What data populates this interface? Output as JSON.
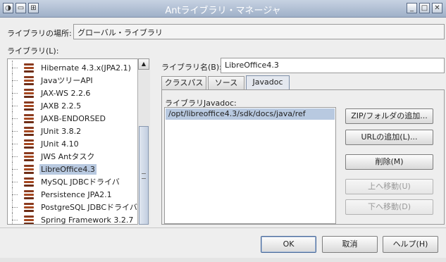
{
  "window": {
    "title": "Antライブラリ・マネージャ",
    "controls": {
      "minimize": "_",
      "maximize": "□",
      "close": "✕"
    }
  },
  "location": {
    "label": "ライブラリの場所:",
    "value": "グローバル・ライブラリ"
  },
  "libraries": {
    "label": "ライブラリ(L):",
    "items": [
      {
        "name": "Hibernate 4.3.x(JPA2.1)",
        "selected": false
      },
      {
        "name": "JavaツリーAPI",
        "selected": false
      },
      {
        "name": "JAX-WS 2.2.6",
        "selected": false
      },
      {
        "name": "JAXB 2.2.5",
        "selected": false
      },
      {
        "name": "JAXB-ENDORSED",
        "selected": false
      },
      {
        "name": "JUnit 3.8.2",
        "selected": false
      },
      {
        "name": "JUnit 4.10",
        "selected": false
      },
      {
        "name": "JWS Antタスク",
        "selected": false
      },
      {
        "name": "LibreOffice4.3",
        "selected": true
      },
      {
        "name": "MySQL JDBCドライバ",
        "selected": false
      },
      {
        "name": "Persistence JPA2.1",
        "selected": false
      },
      {
        "name": "PostgreSQL JDBCドライバ",
        "selected": false
      },
      {
        "name": "Spring Framework 3.2.7",
        "selected": false
      }
    ]
  },
  "library_name": {
    "label": "ライブラリ名(B):",
    "value": "LibreOffice4.3"
  },
  "tabs": [
    {
      "label": "クラスパス",
      "active": false
    },
    {
      "label": "ソース",
      "active": false
    },
    {
      "label": "Javadoc",
      "active": true
    }
  ],
  "javadoc": {
    "label": "ライブラリJavadoc:",
    "paths": [
      "/opt/libreoffice4.3/sdk/docs/java/ref"
    ]
  },
  "side_buttons": {
    "add_zip": "ZIP/フォルダの追加...",
    "add_url": "URLの追加(L)...",
    "remove": "削除(M)",
    "move_up": "上へ移動(U)",
    "move_down": "下へ移動(D)"
  },
  "footer": {
    "ok": "OK",
    "cancel": "取消",
    "help": "ヘルプ(H)"
  },
  "colors": {
    "selection": "#b8c9e0",
    "titlebar": "#9fb0c8"
  }
}
